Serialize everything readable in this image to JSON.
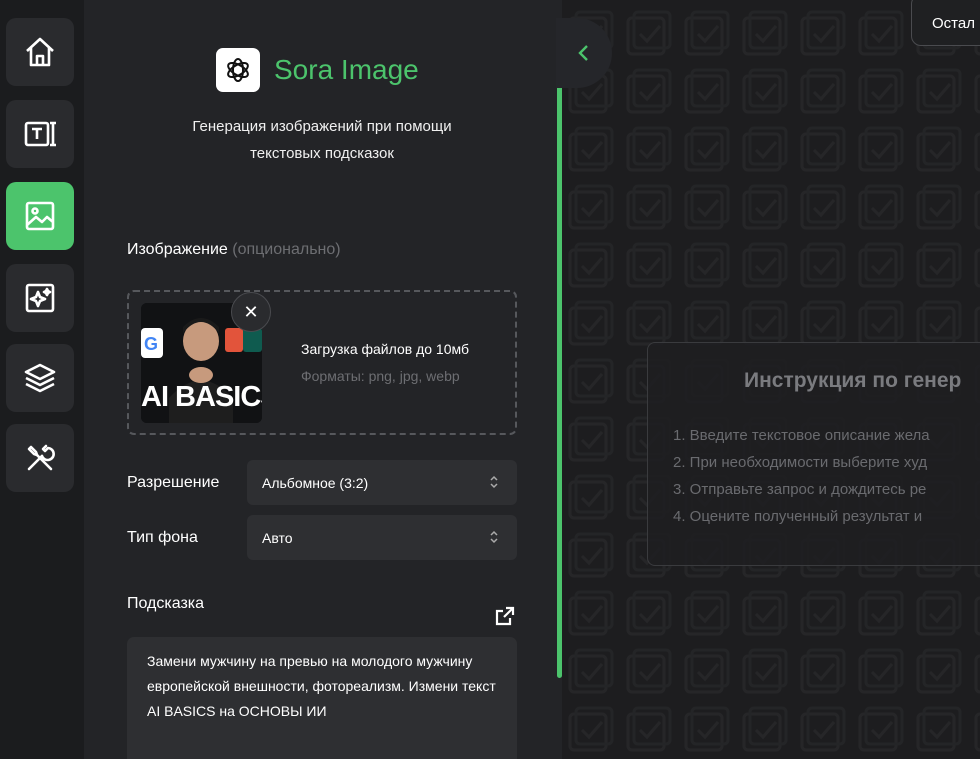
{
  "rail": {
    "items": [
      {
        "id": "home",
        "icon": "home-icon",
        "active": false
      },
      {
        "id": "text",
        "icon": "text-frame-icon",
        "active": false
      },
      {
        "id": "image",
        "icon": "image-icon",
        "active": true
      },
      {
        "id": "enhance",
        "icon": "sparkle-image-icon",
        "active": false
      },
      {
        "id": "layers",
        "icon": "layers-icon",
        "active": false
      },
      {
        "id": "tools",
        "icon": "tools-icon",
        "active": false
      }
    ]
  },
  "panel": {
    "brand_name": "Sora Image",
    "subtitle_line1": "Генерация изображений при помощи",
    "subtitle_line2": "текстовых подсказок",
    "image_label": "Изображение",
    "image_optional": "(опционально)",
    "upload_main": "Загрузка файлов до 10мб",
    "upload_formats": "Форматы: png, jpg, webp",
    "thumb_text": "AI BASICS",
    "resolution_label": "Разрешение",
    "resolution_value": "Альбомное (3:2)",
    "background_label": "Тип фона",
    "background_value": "Авто",
    "prompt_label": "Подсказка",
    "prompt_text": "Замени мужчину на превью на молодого мужчину европейской внешности, фотореализм. Измени текст AI BASICS на ОСНОВЫ ИИ"
  },
  "stage": {
    "topright_text": "Остал",
    "instructions_title": "Инструкция по генер",
    "instructions": [
      "1. Введите текстовое описание жела",
      "2. При необходимости выберите худ",
      "3. Отправьте запрос и дождитесь ре",
      "4. Оцените полученный результат и"
    ]
  },
  "colors": {
    "accent": "#4cc46c",
    "panel_bg": "#232427",
    "rail_btn_bg": "#2a2b2e",
    "field_bg": "#2e2f32"
  }
}
